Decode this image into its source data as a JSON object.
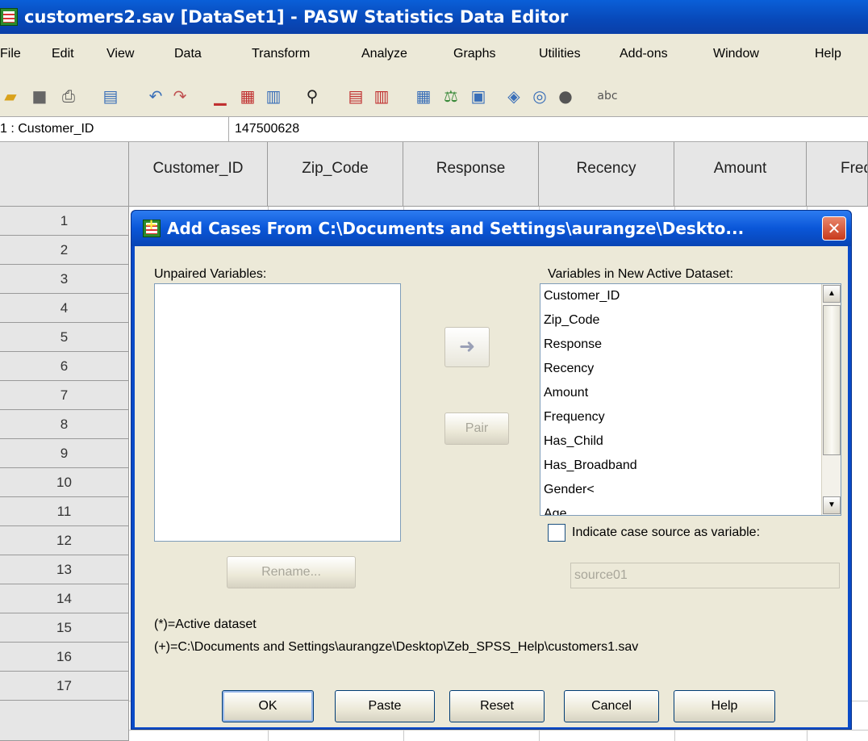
{
  "window": {
    "title": "customers2.sav [DataSet1] - PASW Statistics Data Editor"
  },
  "menu": [
    "File",
    "Edit",
    "View",
    "Data",
    "Transform",
    "Analyze",
    "Graphs",
    "Utilities",
    "Add-ons",
    "Window",
    "Help"
  ],
  "cell_ref": {
    "name": "1 : Customer_ID",
    "value": "147500628"
  },
  "columns": [
    "Customer_ID",
    "Zip_Code",
    "Response",
    "Recency",
    "Amount",
    "Freq"
  ],
  "rows": [
    "1",
    "2",
    "3",
    "4",
    "5",
    "6",
    "7",
    "8",
    "9",
    "10",
    "11",
    "12",
    "13",
    "14",
    "15",
    "16",
    "17"
  ],
  "dialog": {
    "title": "Add Cases From C:\\Documents and Settings\\aurangze\\Deskto...",
    "unpaired_label": "Unpaired Variables:",
    "variables_label": "Variables in New Active Dataset:",
    "variables": [
      "Customer_ID",
      "Zip_Code",
      "Response",
      "Recency",
      "Amount",
      "Frequency",
      "Has_Child",
      "Has_Broadband",
      "Gender<",
      "Age"
    ],
    "pair_button": "Pair",
    "rename_button": "Rename...",
    "indicate_source_label": "Indicate case source as variable:",
    "source_field": "source01",
    "legend_active": "(*)=Active dataset",
    "legend_plus": "(+)=C:\\Documents and Settings\\aurangze\\Desktop\\Zeb_SPSS_Help\\customers1.sav",
    "buttons": {
      "ok": "OK",
      "paste": "Paste",
      "reset": "Reset",
      "cancel": "Cancel",
      "help": "Help"
    }
  }
}
